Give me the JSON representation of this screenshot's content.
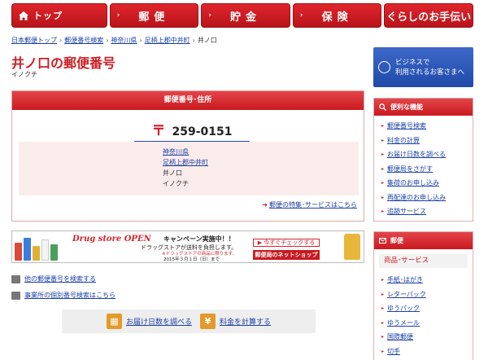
{
  "global_nav": [
    {
      "label": "トップ",
      "icon": "home-icon"
    },
    {
      "label": "郵便"
    },
    {
      "label": "貯金"
    },
    {
      "label": "保険"
    },
    {
      "label": "くらしのお手伝い"
    }
  ],
  "breadcrumb": [
    "日本郵便トップ",
    "郵便番号検索",
    "神奈川県",
    "足柄上郡中井町",
    "井ノ口"
  ],
  "page_title": "井ノ口の郵便番号",
  "page_kana": "イノクチ",
  "result": {
    "header": "郵便番号･住所",
    "zip_mark": "〒",
    "zip_code": "259-0151",
    "address_lines": [
      "神奈川県",
      "足柄上郡中井町",
      "井ノ口",
      "イノクチ"
    ],
    "promo_link": "郵便の特集･サービスはこちら"
  },
  "banner": {
    "brand": "Drug store OPEN",
    "campaign": "キャンペーン実施中！！",
    "line1": "ドラッグストアが送料を負担します。",
    "line2": "※ドラッグストアの商品に限ります。",
    "date": "2015年３月１日（日）まで",
    "check": "▶ 今すぐチェックする",
    "shop": "郵便局のネットショップ"
  },
  "sub_links": [
    "他の郵便番号を検索する",
    "事業所の個別番号検索はこちら"
  ],
  "buttons": [
    {
      "label": "お届け日数を調べる",
      "icon": "calendar-icon"
    },
    {
      "label": "料金を計算する",
      "icon": "yen-icon"
    }
  ],
  "business_banner": [
    "ビジネスで",
    "利用されるお客さまへ"
  ],
  "convenient": {
    "title": "便利な機能",
    "items": [
      "郵便番号検索",
      "料金の計算",
      "お届け日数を調べる",
      "郵便局をさがす",
      "集荷のお申し込み",
      "再配達のお申し込み",
      "追跡サービス"
    ]
  },
  "mail": {
    "title": "郵便",
    "subtitle": "商品･サービス",
    "items": [
      "手紙･はがき",
      "レターパック",
      "ゆうパック",
      "ゆうメール",
      "国際郵便",
      "切手"
    ]
  },
  "colors": {
    "accent": "#cc1e25",
    "link": "#1a3fa8",
    "business": "#2a55b8"
  }
}
